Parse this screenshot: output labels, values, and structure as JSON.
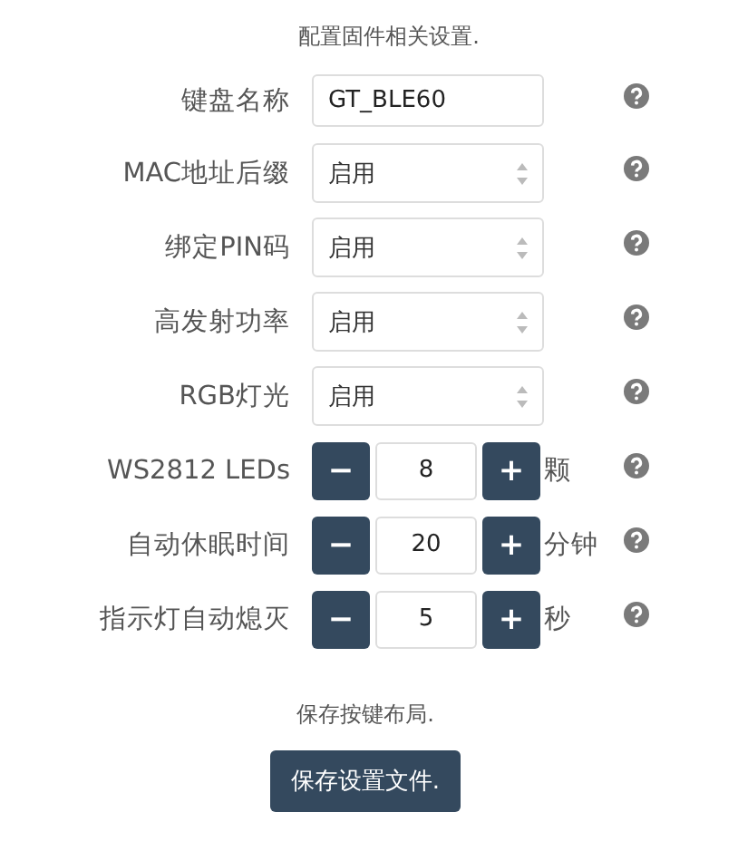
{
  "intro": "配置固件相关设置.",
  "settings": [
    {
      "kind": "text",
      "label": "键盘名称",
      "value": "GT_BLE60"
    },
    {
      "kind": "select",
      "label": "MAC地址后缀",
      "value": "启用"
    },
    {
      "kind": "select",
      "label": "绑定PIN码",
      "value": "启用"
    },
    {
      "kind": "select",
      "label": "高发射功率",
      "value": "启用"
    },
    {
      "kind": "select",
      "label": "RGB灯光",
      "value": "启用"
    },
    {
      "kind": "stepper",
      "label": "WS2812 LEDs",
      "value": "8",
      "minus": "−",
      "plus": "+",
      "unit": "颗"
    },
    {
      "kind": "stepper",
      "label": "自动休眠时间",
      "value": "20",
      "minus": "−",
      "plus": "+",
      "unit": "分钟"
    },
    {
      "kind": "stepper",
      "label": "指示灯自动熄灭",
      "value": "5",
      "minus": "−",
      "plus": "+",
      "unit": "秒"
    }
  ],
  "footer_text": "保存按键布局.",
  "save_button": "保存设置文件."
}
